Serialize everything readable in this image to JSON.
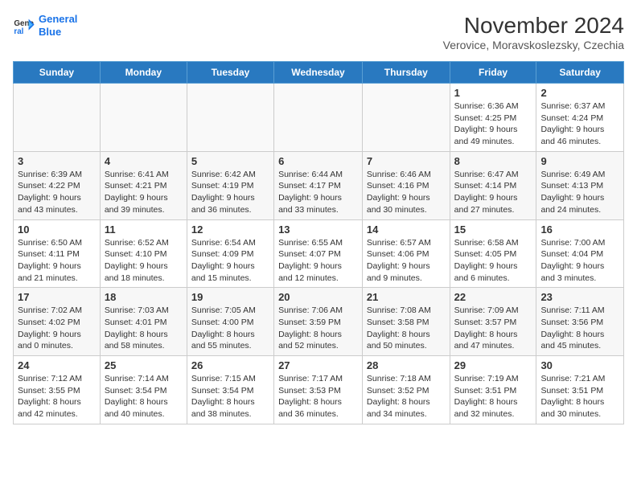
{
  "logo": {
    "line1": "General",
    "line2": "Blue"
  },
  "title": "November 2024",
  "subtitle": "Verovice, Moravskoslezsky, Czechia",
  "weekdays": [
    "Sunday",
    "Monday",
    "Tuesday",
    "Wednesday",
    "Thursday",
    "Friday",
    "Saturday"
  ],
  "weeks": [
    [
      {
        "day": "",
        "info": ""
      },
      {
        "day": "",
        "info": ""
      },
      {
        "day": "",
        "info": ""
      },
      {
        "day": "",
        "info": ""
      },
      {
        "day": "",
        "info": ""
      },
      {
        "day": "1",
        "info": "Sunrise: 6:36 AM\nSunset: 4:25 PM\nDaylight: 9 hours\nand 49 minutes."
      },
      {
        "day": "2",
        "info": "Sunrise: 6:37 AM\nSunset: 4:24 PM\nDaylight: 9 hours\nand 46 minutes."
      }
    ],
    [
      {
        "day": "3",
        "info": "Sunrise: 6:39 AM\nSunset: 4:22 PM\nDaylight: 9 hours\nand 43 minutes."
      },
      {
        "day": "4",
        "info": "Sunrise: 6:41 AM\nSunset: 4:21 PM\nDaylight: 9 hours\nand 39 minutes."
      },
      {
        "day": "5",
        "info": "Sunrise: 6:42 AM\nSunset: 4:19 PM\nDaylight: 9 hours\nand 36 minutes."
      },
      {
        "day": "6",
        "info": "Sunrise: 6:44 AM\nSunset: 4:17 PM\nDaylight: 9 hours\nand 33 minutes."
      },
      {
        "day": "7",
        "info": "Sunrise: 6:46 AM\nSunset: 4:16 PM\nDaylight: 9 hours\nand 30 minutes."
      },
      {
        "day": "8",
        "info": "Sunrise: 6:47 AM\nSunset: 4:14 PM\nDaylight: 9 hours\nand 27 minutes."
      },
      {
        "day": "9",
        "info": "Sunrise: 6:49 AM\nSunset: 4:13 PM\nDaylight: 9 hours\nand 24 minutes."
      }
    ],
    [
      {
        "day": "10",
        "info": "Sunrise: 6:50 AM\nSunset: 4:11 PM\nDaylight: 9 hours\nand 21 minutes."
      },
      {
        "day": "11",
        "info": "Sunrise: 6:52 AM\nSunset: 4:10 PM\nDaylight: 9 hours\nand 18 minutes."
      },
      {
        "day": "12",
        "info": "Sunrise: 6:54 AM\nSunset: 4:09 PM\nDaylight: 9 hours\nand 15 minutes."
      },
      {
        "day": "13",
        "info": "Sunrise: 6:55 AM\nSunset: 4:07 PM\nDaylight: 9 hours\nand 12 minutes."
      },
      {
        "day": "14",
        "info": "Sunrise: 6:57 AM\nSunset: 4:06 PM\nDaylight: 9 hours\nand 9 minutes."
      },
      {
        "day": "15",
        "info": "Sunrise: 6:58 AM\nSunset: 4:05 PM\nDaylight: 9 hours\nand 6 minutes."
      },
      {
        "day": "16",
        "info": "Sunrise: 7:00 AM\nSunset: 4:04 PM\nDaylight: 9 hours\nand 3 minutes."
      }
    ],
    [
      {
        "day": "17",
        "info": "Sunrise: 7:02 AM\nSunset: 4:02 PM\nDaylight: 9 hours\nand 0 minutes."
      },
      {
        "day": "18",
        "info": "Sunrise: 7:03 AM\nSunset: 4:01 PM\nDaylight: 8 hours\nand 58 minutes."
      },
      {
        "day": "19",
        "info": "Sunrise: 7:05 AM\nSunset: 4:00 PM\nDaylight: 8 hours\nand 55 minutes."
      },
      {
        "day": "20",
        "info": "Sunrise: 7:06 AM\nSunset: 3:59 PM\nDaylight: 8 hours\nand 52 minutes."
      },
      {
        "day": "21",
        "info": "Sunrise: 7:08 AM\nSunset: 3:58 PM\nDaylight: 8 hours\nand 50 minutes."
      },
      {
        "day": "22",
        "info": "Sunrise: 7:09 AM\nSunset: 3:57 PM\nDaylight: 8 hours\nand 47 minutes."
      },
      {
        "day": "23",
        "info": "Sunrise: 7:11 AM\nSunset: 3:56 PM\nDaylight: 8 hours\nand 45 minutes."
      }
    ],
    [
      {
        "day": "24",
        "info": "Sunrise: 7:12 AM\nSunset: 3:55 PM\nDaylight: 8 hours\nand 42 minutes."
      },
      {
        "day": "25",
        "info": "Sunrise: 7:14 AM\nSunset: 3:54 PM\nDaylight: 8 hours\nand 40 minutes."
      },
      {
        "day": "26",
        "info": "Sunrise: 7:15 AM\nSunset: 3:54 PM\nDaylight: 8 hours\nand 38 minutes."
      },
      {
        "day": "27",
        "info": "Sunrise: 7:17 AM\nSunset: 3:53 PM\nDaylight: 8 hours\nand 36 minutes."
      },
      {
        "day": "28",
        "info": "Sunrise: 7:18 AM\nSunset: 3:52 PM\nDaylight: 8 hours\nand 34 minutes."
      },
      {
        "day": "29",
        "info": "Sunrise: 7:19 AM\nSunset: 3:51 PM\nDaylight: 8 hours\nand 32 minutes."
      },
      {
        "day": "30",
        "info": "Sunrise: 7:21 AM\nSunset: 3:51 PM\nDaylight: 8 hours\nand 30 minutes."
      }
    ]
  ]
}
